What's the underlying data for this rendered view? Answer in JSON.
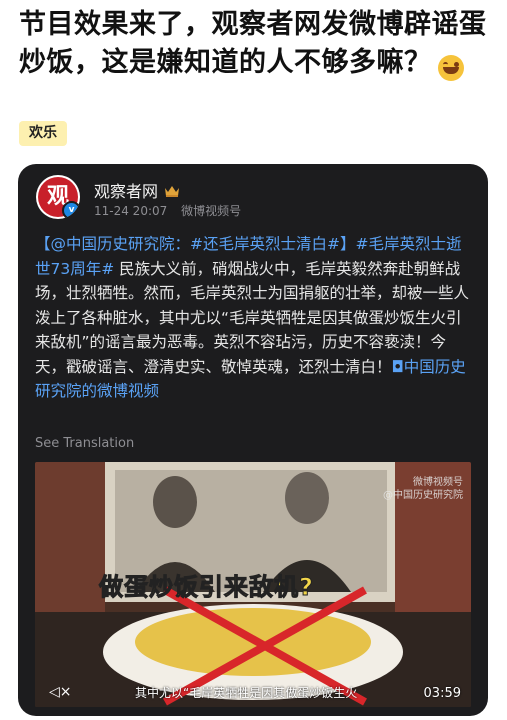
{
  "headline": {
    "title": "节目效果来了，观察者网发微博辟谣蛋炒饭，这是嫌知道的人不够多嘛？"
  },
  "tag": {
    "label": "欢乐"
  },
  "post": {
    "author": "观察者网",
    "time": "11-24 20:07",
    "source": "微博视频号",
    "mention": "@中国历史研究院",
    "colon": "：",
    "hashtag1": "#还毛岸英烈士清白#",
    "bracket_open": "【",
    "bracket_close": "】",
    "hashtag2": "#毛岸英烈士逝世73周年#",
    "body": " 民族大义前，硝烟战火中，毛岸英毅然奔赴朝鲜战场，壮烈牺牲。然而，毛岸英烈士为国捐躯的壮举，却被一些人泼上了各种脏水，其中尤以“毛岸英牺牲是因其做蛋炒饭生火引来敌机”的谣言最为恶毒。英烈不容玷污，历史不容亵渎！今天，戳破谣言、澄清史实、敬悼英魂，还烈士清白！",
    "video_link": "中国历史研究院的微博视频",
    "translate": "See Translation"
  },
  "video": {
    "overlay_text": "做蛋炒饭引来敌机?",
    "subtitle": "其中尤以“毛岸英牺牲是因其做蛋炒饭生火",
    "duration": "03:59",
    "watermark_line1": "微博视频号",
    "watermark_line2": "@中国历史研究院"
  }
}
